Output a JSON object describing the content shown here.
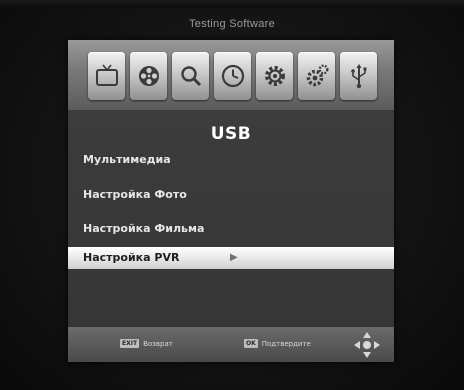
{
  "header": {
    "app_title": "Testing Software"
  },
  "icon_bar": {
    "icons": [
      {
        "name": "tv-icon"
      },
      {
        "name": "film-reel-icon"
      },
      {
        "name": "search-icon"
      },
      {
        "name": "clock-icon"
      },
      {
        "name": "settings-gear-icon"
      },
      {
        "name": "system-gears-icon"
      },
      {
        "name": "usb-icon"
      }
    ],
    "active_index": 6
  },
  "menu": {
    "title": "USB",
    "items": [
      {
        "label": "Мультимедиа"
      },
      {
        "label": "Настройка Фото"
      },
      {
        "label": "Настройка Фильма"
      },
      {
        "label": "Настройка PVR",
        "selected": true
      }
    ]
  },
  "footer": {
    "back_key": "EXIT",
    "back_label": "Возврат",
    "ok_key": "OK",
    "ok_label": "Подтвердите"
  },
  "colors": {
    "menu_background": "#3a3a3a",
    "selection_highlight": "#e6e6e6",
    "icon_tile": "#c9c9c9"
  }
}
